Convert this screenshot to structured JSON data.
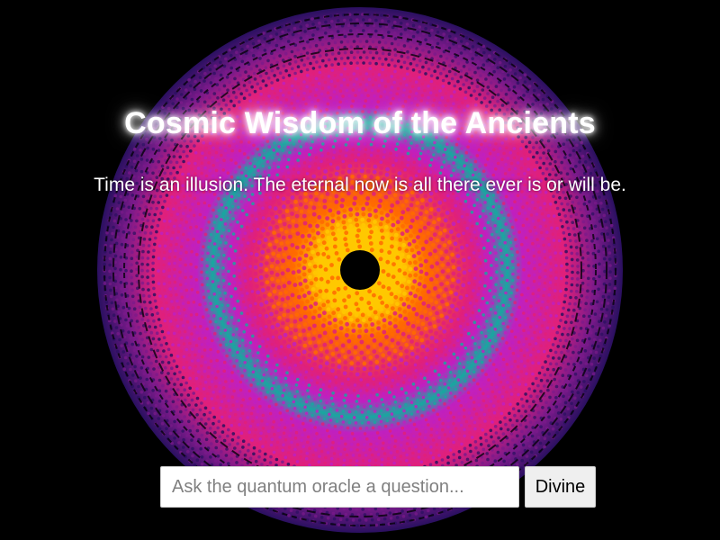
{
  "page": {
    "background_color": "#000000"
  },
  "oracle": {
    "title": "Cosmic Wisdom of the Ancients",
    "wisdom_text": "Time is an illusion. The eternal now is all there ever is or will be.",
    "question_input": {
      "value": "",
      "placeholder": "Ask the quantum oracle a question..."
    },
    "divine_button_label": "Divine"
  },
  "visual": {
    "icon": "cosmic-mandala",
    "palette": {
      "core": "#000000",
      "center": "#ffc800",
      "inner": "#ff6a00",
      "mid": "#e0207a",
      "teal_ring": "#1aa6a0",
      "magenta": "#c020c0",
      "outer": "#7a1a8a",
      "edge": "#2a1060"
    }
  }
}
